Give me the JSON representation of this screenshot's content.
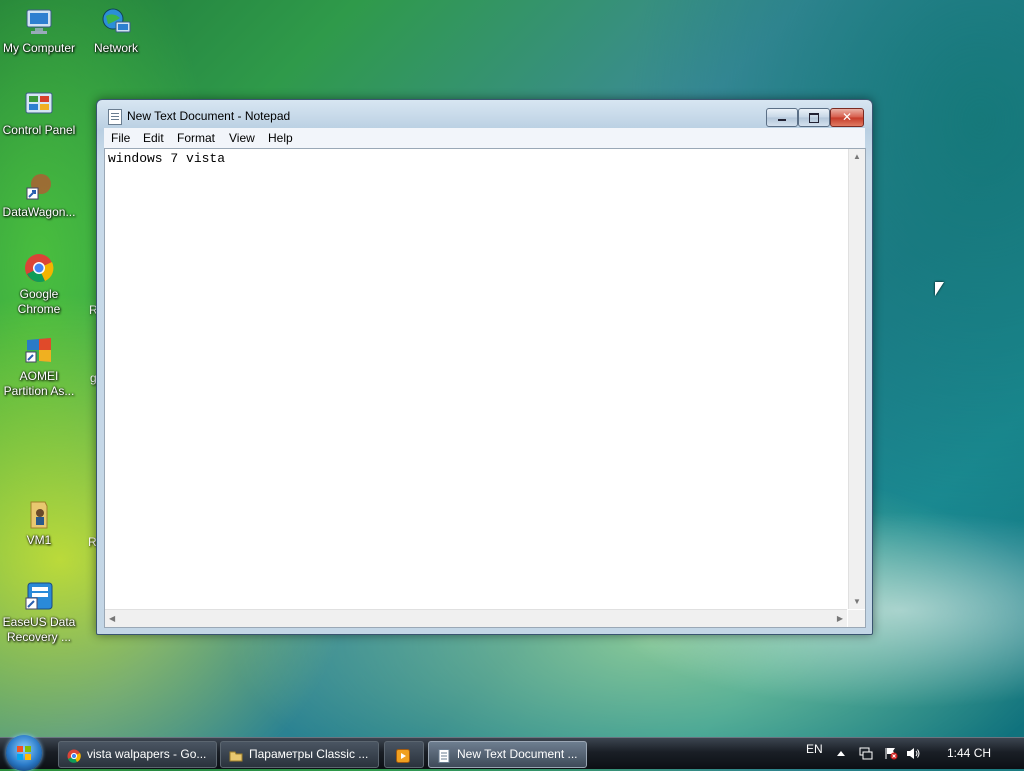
{
  "desktop": {
    "icons": [
      {
        "label": "My Computer",
        "icon": "computer-icon"
      },
      {
        "label": "Network",
        "icon": "network-icon"
      },
      {
        "label": "Control Panel",
        "icon": "control-panel-icon"
      },
      {
        "label": "DataWagon...",
        "icon": "shortcut-icon"
      },
      {
        "label": "Google Chrome",
        "icon": "chrome-icon"
      },
      {
        "label": "AOMEI Partition As...",
        "icon": "aomei-icon"
      },
      {
        "label": "VM1",
        "icon": "folder-icon"
      },
      {
        "label": "EaseUS Data Recovery ...",
        "icon": "easeus-icon"
      }
    ],
    "partial_labels": [
      "R",
      "g",
      "R"
    ]
  },
  "notepad": {
    "title": "New Text Document - Notepad",
    "menu": [
      "File",
      "Edit",
      "Format",
      "View",
      "Help"
    ],
    "content": "windows 7 vista",
    "controls": {
      "minimize": "minimize",
      "maximize": "maximize",
      "close": "✕"
    }
  },
  "taskbar": {
    "buttons": [
      {
        "label": "vista walpapers - Go...",
        "icon": "chrome-icon",
        "active": false
      },
      {
        "label": "Параметры Classic ...",
        "icon": "folder-icon",
        "active": false
      },
      {
        "label": "",
        "icon": "media-player-icon",
        "active": false
      },
      {
        "label": "New Text Document ...",
        "icon": "notepad-icon",
        "active": true
      }
    ],
    "tray": {
      "language": "EN",
      "clock": "1:44 CH",
      "icons": [
        "show-hidden-icon",
        "network-status-icon",
        "action-center-icon",
        "volume-icon"
      ]
    }
  },
  "colors": {
    "taskbar": "#1a1f26",
    "close_button": "#c53a28",
    "window_frame": "#b9cfe2"
  }
}
